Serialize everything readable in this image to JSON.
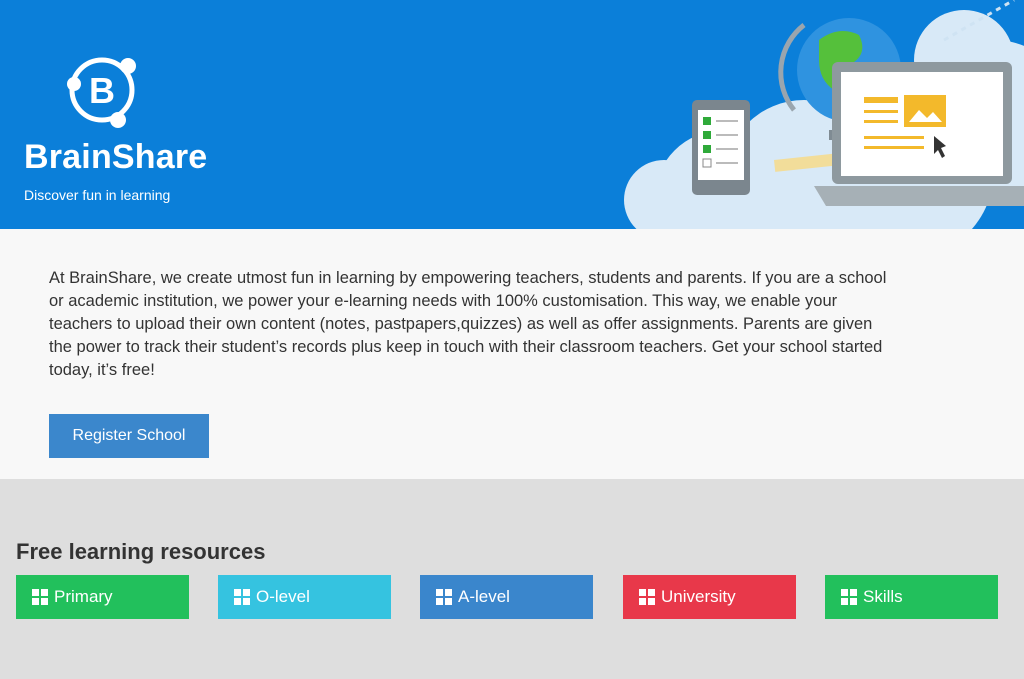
{
  "brand": {
    "name": "BrainShare",
    "tagline": "Discover fun in learning",
    "logo_letter": "B"
  },
  "intro": {
    "text": "At BrainShare, we create utmost fun in learning by empowering teachers, students and parents. If you are a school or academic institution, we power your e-learning needs with 100% customisation. This way, we enable your teachers to upload their own content (notes, pastpapers,quizzes) as well as offer assignments. Parents are given the power to track their student’s records plus keep in touch with their classroom teachers. Get your school started today, it’s free!",
    "button_label": "Register School"
  },
  "resources": {
    "title": "Free learning resources",
    "categories": [
      {
        "label": "Primary",
        "color": "#22c05c"
      },
      {
        "label": "O-level",
        "color": "#35c3e0"
      },
      {
        "label": "A-level",
        "color": "#3a86cc"
      },
      {
        "label": "University",
        "color": "#e8384a"
      },
      {
        "label": "Skills",
        "color": "#22c05c"
      }
    ]
  },
  "colors": {
    "hero_bg": "#0b7fd9",
    "button": "#3b87cc"
  }
}
